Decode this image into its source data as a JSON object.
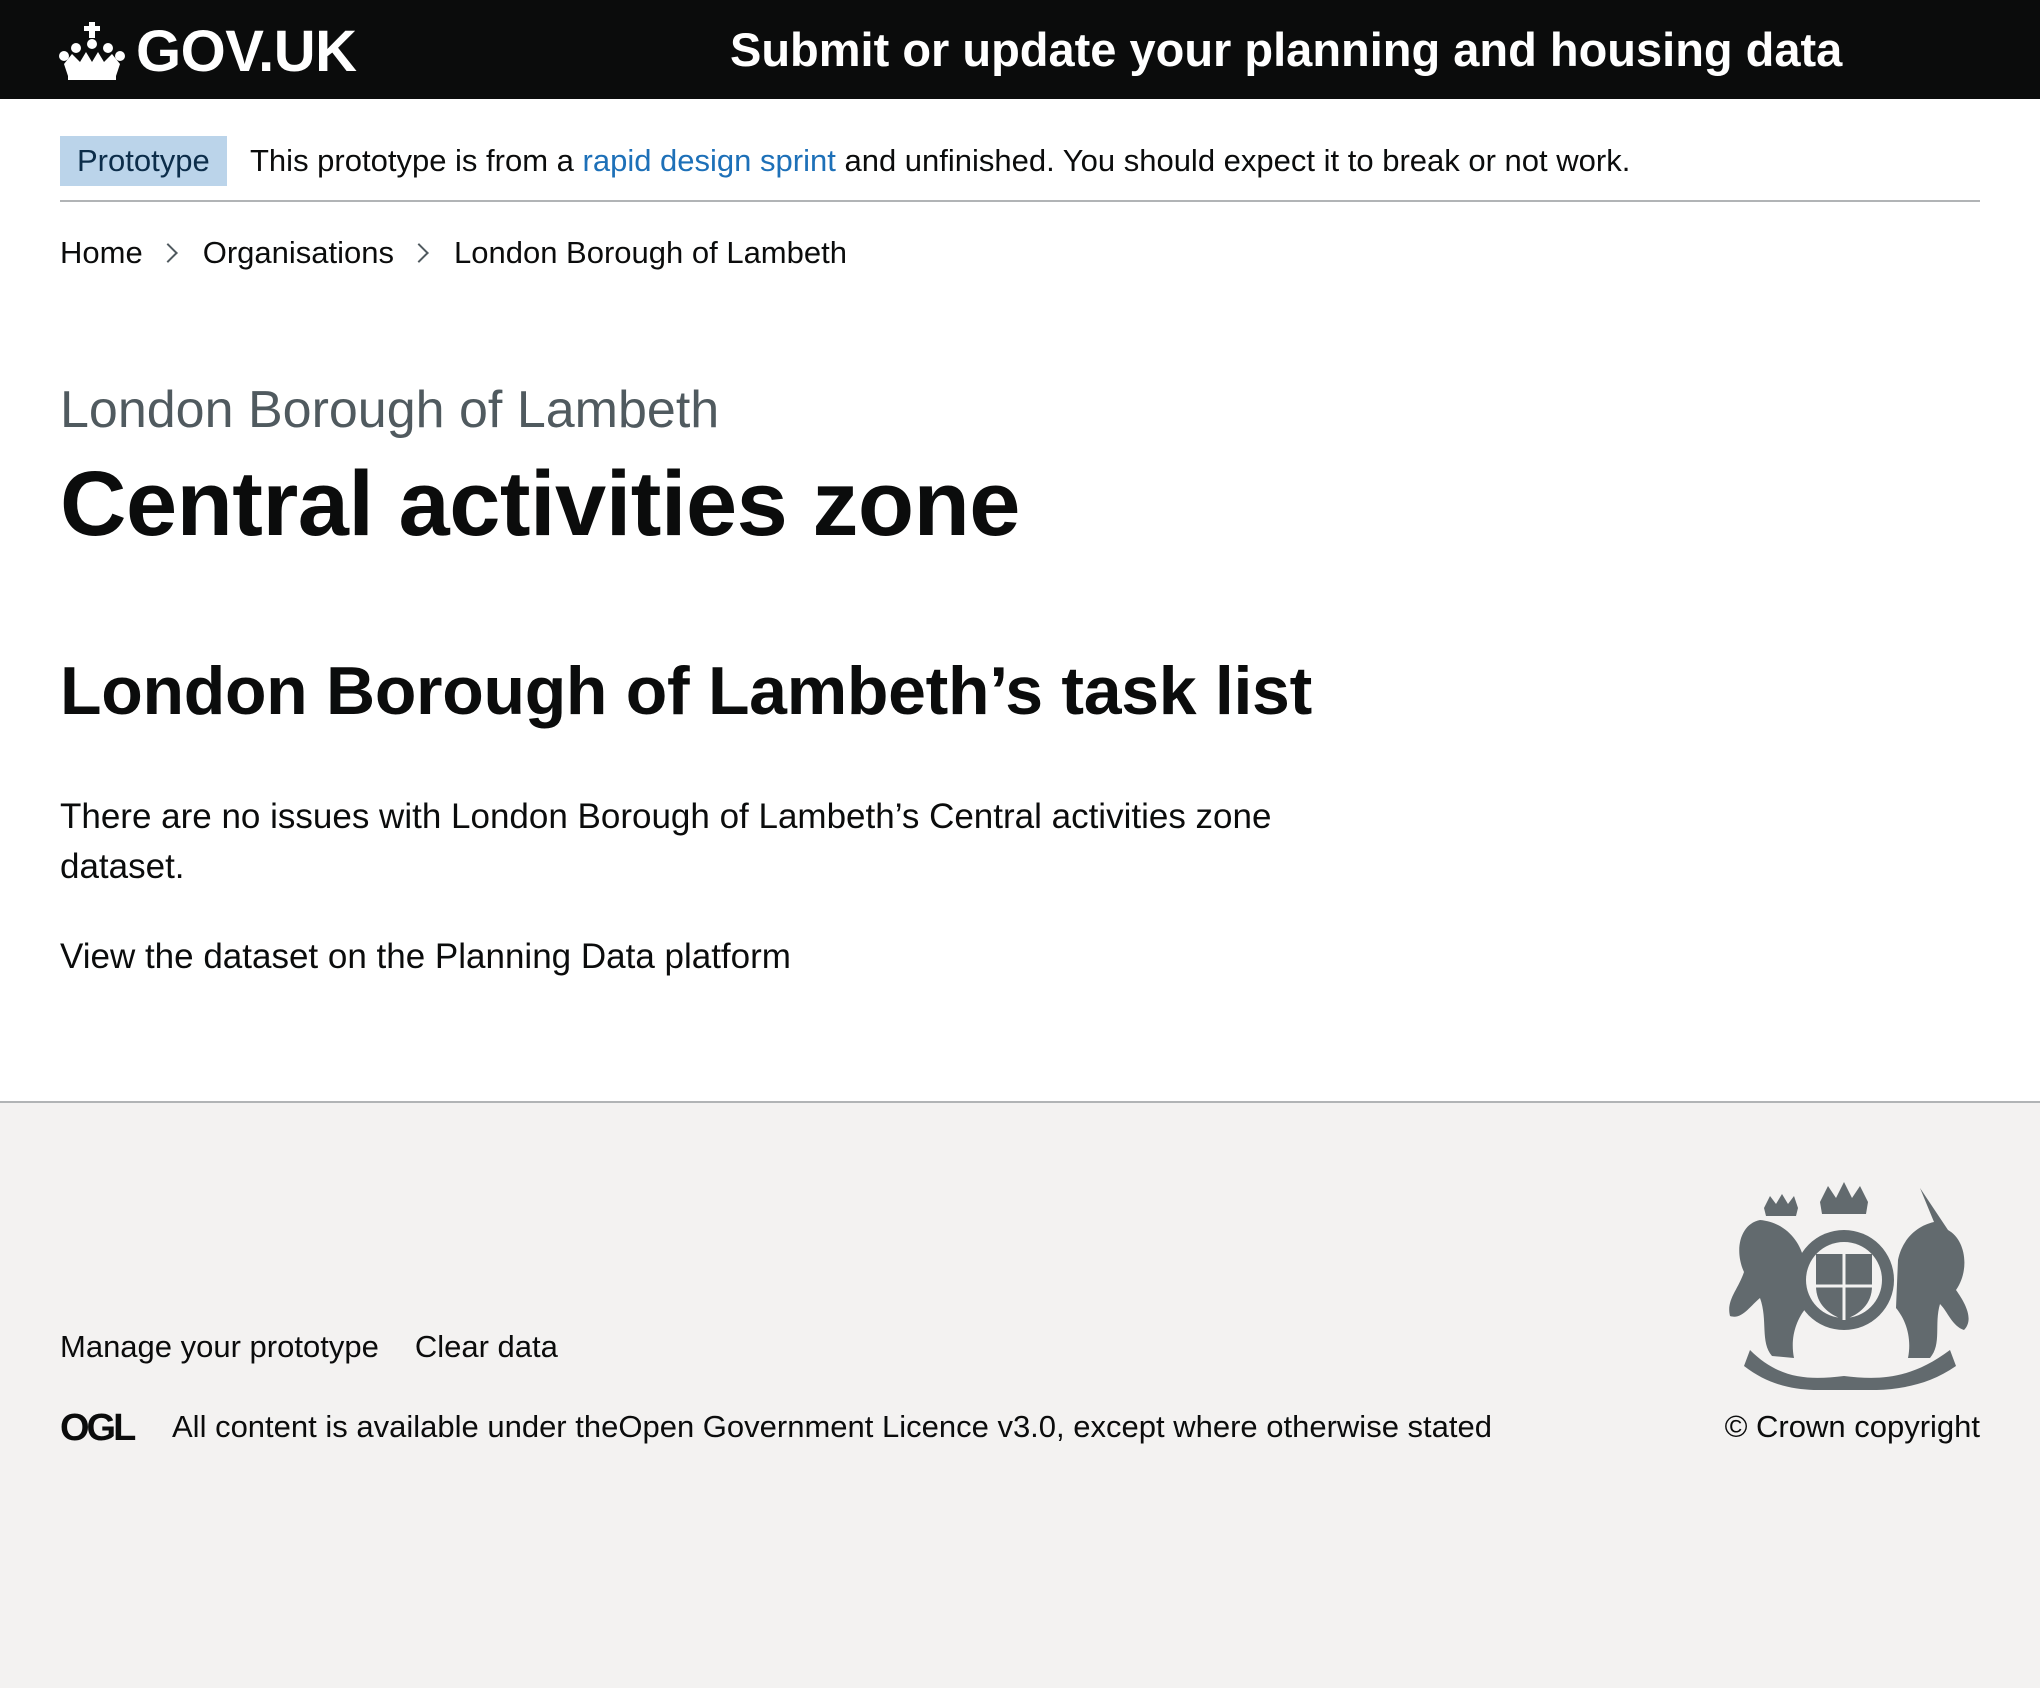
{
  "header": {
    "logo_text": "GOV.UK",
    "service_name": "Submit or update your planning and housing data",
    "background_color": "#0b0c0c",
    "accent_color": "#1d70b8"
  },
  "phase_banner": {
    "tag": "Prototype",
    "text_before": "This prototype is from a ",
    "link_text": "rapid design sprint",
    "text_after": " and unfinished. You should expect it to break or not work."
  },
  "breadcrumbs": [
    {
      "label": "Home"
    },
    {
      "label": "Organisations"
    },
    {
      "label": "London Borough of Lambeth"
    }
  ],
  "main": {
    "caption": "London Borough of Lambeth",
    "title": "Central activities zone",
    "task_list_heading": "London Borough of Lambeth’s task list",
    "no_issues_text": "There are no issues with London Borough of Lambeth’s Central activities zone dataset.",
    "view_dataset_text": "View the dataset on the Planning Data platform"
  },
  "footer": {
    "links": [
      {
        "label": "Manage your prototype"
      },
      {
        "label": "Clear data"
      }
    ],
    "licence_before": "All content is available under the ",
    "licence_link": "Open Government Licence v3.0",
    "licence_after": ", except where otherwise stated",
    "copyright": "© Crown copyright",
    "ogl_logo": "OGL",
    "background_color": "#f3f2f1"
  }
}
